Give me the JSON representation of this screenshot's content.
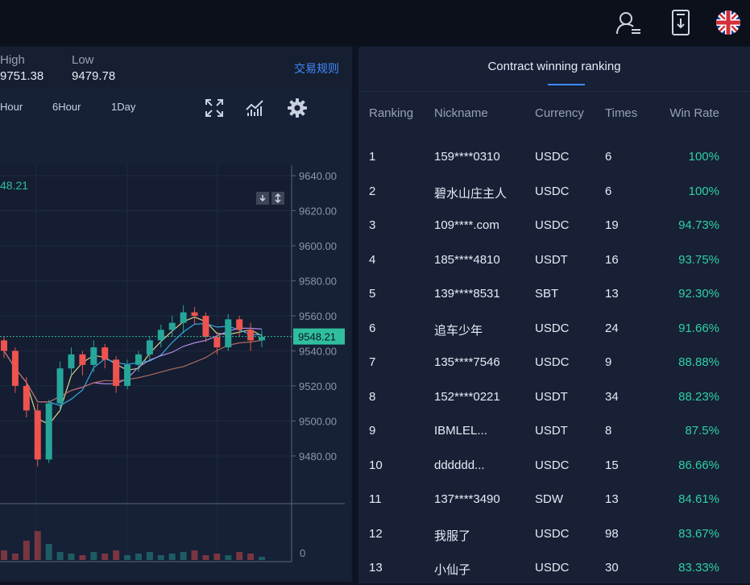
{
  "header": {
    "icons": [
      "user-list-icon",
      "download-app-icon",
      "uk-flag-icon"
    ]
  },
  "market": {
    "high_label": "High",
    "high_value": "9751.38",
    "low_label": "Low",
    "low_value": "9479.78",
    "rules_link": "交易规则"
  },
  "periods": [
    "Hour",
    "6Hour",
    "1Day"
  ],
  "chart_data": {
    "type": "candlestick",
    "last_price_label": "48.21",
    "current_price": 9548.21,
    "current_price_tag": "9548.21",
    "y_ticks": [
      "9640.00",
      "9620.00",
      "9600.00",
      "9580.00",
      "9560.00",
      "9540.00",
      "9520.00",
      "9500.00",
      "9480.00"
    ],
    "y_tick_values": [
      9640,
      9620,
      9600,
      9580,
      9560,
      9540,
      9520,
      9500,
      9480
    ],
    "ylim": [
      9462,
      9646
    ],
    "volume_zero_label": "0",
    "candles": [
      [
        9546,
        9540,
        9548,
        9536
      ],
      [
        9540,
        9520,
        9542,
        9516
      ],
      [
        9520,
        9506,
        9525,
        9502
      ],
      [
        9506,
        9478,
        9510,
        9474
      ],
      [
        9478,
        9510,
        9512,
        9476
      ],
      [
        9510,
        9530,
        9534,
        9506
      ],
      [
        9530,
        9538,
        9542,
        9526
      ],
      [
        9538,
        9532,
        9540,
        9526
      ],
      [
        9532,
        9542,
        9546,
        9528
      ],
      [
        9542,
        9535,
        9544,
        9530
      ],
      [
        9535,
        9520,
        9537,
        9516
      ],
      [
        9520,
        9532,
        9535,
        9518
      ],
      [
        9532,
        9538,
        9540,
        9528
      ],
      [
        9538,
        9546,
        9548,
        9534
      ],
      [
        9546,
        9552,
        9555,
        9542
      ],
      [
        9552,
        9556,
        9560,
        9548
      ],
      [
        9556,
        9562,
        9566,
        9550
      ],
      [
        9562,
        9560,
        9565,
        9555
      ],
      [
        9560,
        9548,
        9562,
        9545
      ],
      [
        9548,
        9542,
        9550,
        9538
      ],
      [
        9542,
        9558,
        9561,
        9540
      ],
      [
        9558,
        9552,
        9560,
        9548
      ],
      [
        9552,
        9546,
        9556,
        9540
      ],
      [
        9546,
        9548,
        9552,
        9542
      ]
    ],
    "volumes": [
      6,
      4,
      12,
      18,
      10,
      5,
      4,
      3,
      5,
      4,
      6,
      3,
      4,
      5,
      3,
      4,
      5,
      6,
      3,
      4,
      3,
      5,
      4,
      2
    ]
  },
  "ranking": {
    "title": "Contract winning ranking",
    "columns": [
      "Ranking",
      "Nickname",
      "Currency",
      "Times",
      "Win Rate"
    ],
    "rows": [
      [
        "1",
        "159****0310",
        "USDC",
        "6",
        "100%"
      ],
      [
        "2",
        "碧水山庄主人",
        "USDC",
        "6",
        "100%"
      ],
      [
        "3",
        "109****.com",
        "USDC",
        "19",
        "94.73%"
      ],
      [
        "4",
        "185****4810",
        "USDT",
        "16",
        "93.75%"
      ],
      [
        "5",
        "139****8531",
        "SBT",
        "13",
        "92.30%"
      ],
      [
        "6",
        "追车少年",
        "USDC",
        "24",
        "91.66%"
      ],
      [
        "7",
        "135****7546",
        "USDC",
        "9",
        "88.88%"
      ],
      [
        "8",
        "152****0221",
        "USDT",
        "34",
        "88.23%"
      ],
      [
        "9",
        "IBMLEL...",
        "USDT",
        "8",
        "87.5%"
      ],
      [
        "10",
        "dddddd...",
        "USDC",
        "15",
        "86.66%"
      ],
      [
        "11",
        "137****3490",
        "SDW",
        "13",
        "84.61%"
      ],
      [
        "12",
        "我服了",
        "USDC",
        "98",
        "83.67%"
      ],
      [
        "13",
        "小仙子",
        "USDC",
        "30",
        "83.33%"
      ]
    ]
  },
  "colors": {
    "up": "#26a69a",
    "down": "#ef5350",
    "win_rate": "#30d0a4",
    "accent": "#3d8bfd"
  }
}
